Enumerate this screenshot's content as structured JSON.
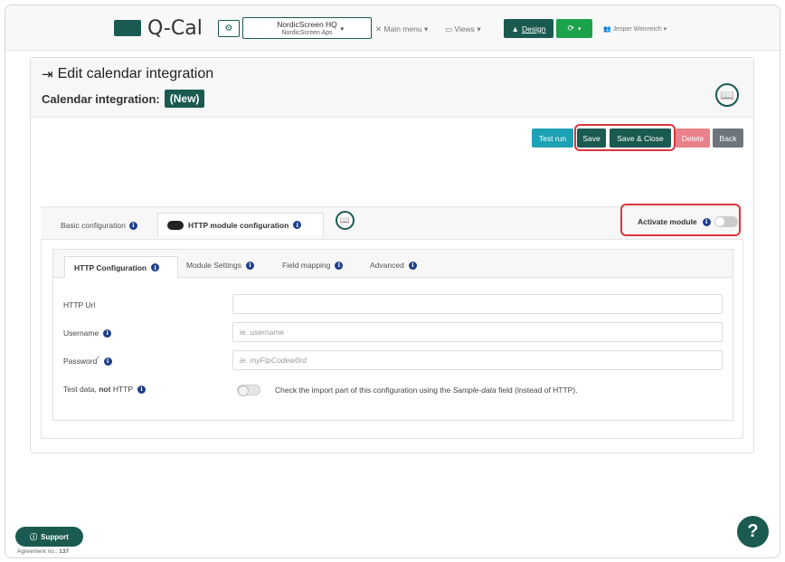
{
  "app": {
    "name": "Q-Cal",
    "company": "NordicScreen HQ",
    "company_sub": "NordicScreen Aps",
    "main_menu": "Main menu",
    "views": "Views",
    "design": "Design",
    "user": "Jesper Weinreich"
  },
  "page": {
    "title": "Edit calendar integration",
    "subtitle": "Calendar integration:",
    "badge": "(New)"
  },
  "actions": {
    "test_run": "Test run",
    "save": "Save",
    "save_close": "Save & Close",
    "delete": "Delete",
    "back": "Back"
  },
  "outer_tabs": {
    "basic": "Basic configuration",
    "http": "HTTP module configuration",
    "activate": "Activate module"
  },
  "inner_tabs": {
    "http_config": "HTTP Configuration",
    "module_settings": "Module Settings",
    "field_mapping": "Field mapping",
    "advanced": "Advanced"
  },
  "form": {
    "http_url_label": "HTTP Url",
    "http_url_value": "",
    "username_label": "Username",
    "username_placeholder": "ie. username",
    "password_label": "Password",
    "password_required": "*",
    "password_placeholder": "ie. myFtpCodew0rd",
    "testdata_label_pre": "Test data,",
    "testdata_label_not": "not",
    "testdata_label_post": "HTTP",
    "testdata_desc_pre": "Check the import part of this configuration using the",
    "testdata_desc_em": "Sample-data",
    "testdata_desc_post": "field (instead of HTTP)."
  },
  "footer": {
    "support": "Support",
    "agreement_label": "Agreement no.:",
    "agreement_no": "137",
    "help": "?"
  },
  "colors": {
    "brand": "#1b5a50",
    "teal_btn": "#1da1b4",
    "delete_btn": "#e8818a",
    "back_btn": "#6c757d",
    "highlight": "#d9363e",
    "info": "#1d3f8a"
  }
}
